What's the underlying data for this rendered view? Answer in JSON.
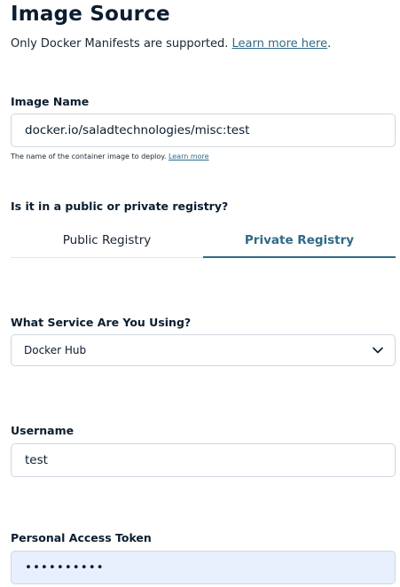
{
  "header": {
    "title": "Image Source",
    "subtitle_text": "Only Docker Manifests are supported. ",
    "subtitle_link": "Learn more here",
    "subtitle_period": "."
  },
  "image_name": {
    "label": "Image Name",
    "value": "docker.io/saladtechnologies/misc:test",
    "hint_text": "The name of the container image to deploy. ",
    "hint_link": "Learn more"
  },
  "registry": {
    "label": "Is it in a public or private registry?",
    "tabs": [
      {
        "label": "Public Registry",
        "active": false
      },
      {
        "label": "Private Registry",
        "active": true
      }
    ]
  },
  "service": {
    "label": "What Service Are You Using?",
    "selected": "Docker Hub"
  },
  "username": {
    "label": "Username",
    "value": "test"
  },
  "token": {
    "label": "Personal Access Token",
    "masked_value": "••••••••••"
  },
  "colors": {
    "accent": "#2f6a86",
    "text": "#0b1d2e",
    "border": "#cfd6dd",
    "autofill_bg": "#e8f0fe"
  },
  "icons": {
    "select_chevron": "chevron-down-icon"
  }
}
